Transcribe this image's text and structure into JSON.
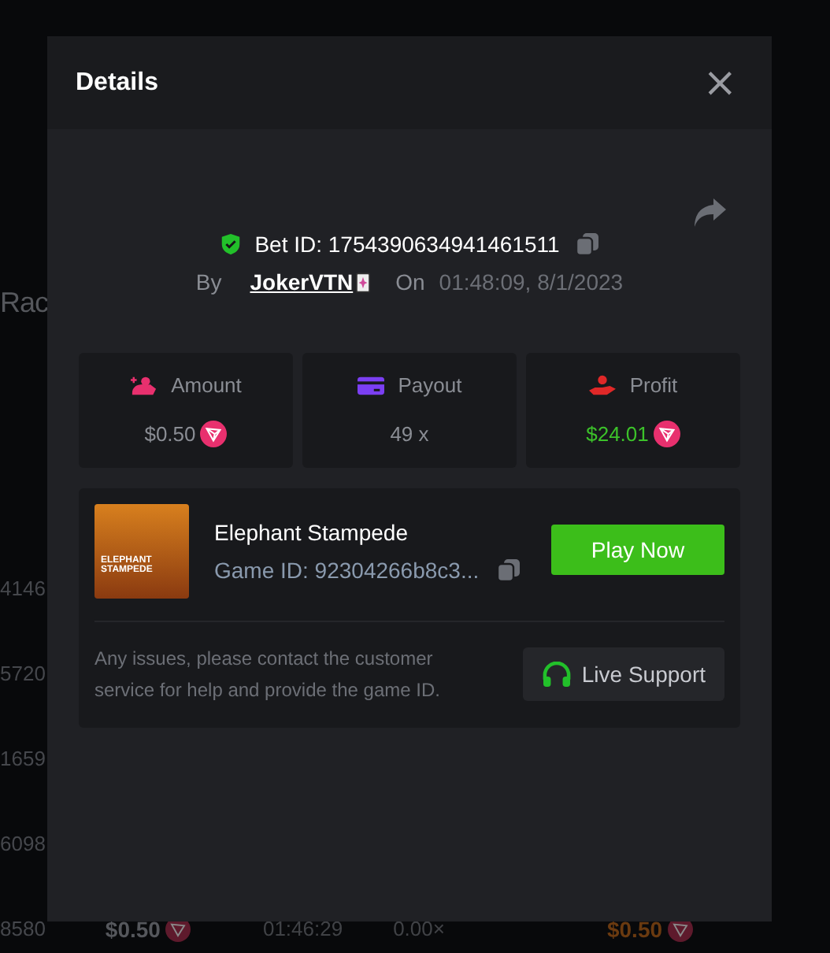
{
  "background": {
    "heading": "Rac",
    "row_ids": [
      "4146",
      "5720",
      "1659",
      "6098"
    ],
    "last_row": {
      "id": "8580",
      "amount": "$0.50",
      "time": "01:46:29",
      "payout": "0.00×",
      "profit": "$0.50"
    }
  },
  "dialog": {
    "title": "Details",
    "close": "×",
    "bet_id": "Bet ID: 1754390634941461511",
    "by_label": "By",
    "user": "JokerVTN",
    "on_label": "On",
    "datetime": "01:48:09, 8/1/2023",
    "stats": [
      {
        "kind": "amount",
        "label": "Amount",
        "value": "$0.50",
        "coin": true
      },
      {
        "kind": "payout",
        "label": "Payout",
        "value": "49 x",
        "coin": false
      },
      {
        "kind": "profit",
        "label": "Profit",
        "value": "$24.01",
        "coin": true
      }
    ],
    "game": {
      "name": "Elephant Stampede",
      "game_id": "Game ID: 92304266b8c3...",
      "thumb_text": "ELEPHANT STAMPEDE",
      "play_button": "Play Now"
    },
    "help_text": "Any issues, please contact the customer service for help and provide the game ID.",
    "support_button": "Live Support"
  }
}
